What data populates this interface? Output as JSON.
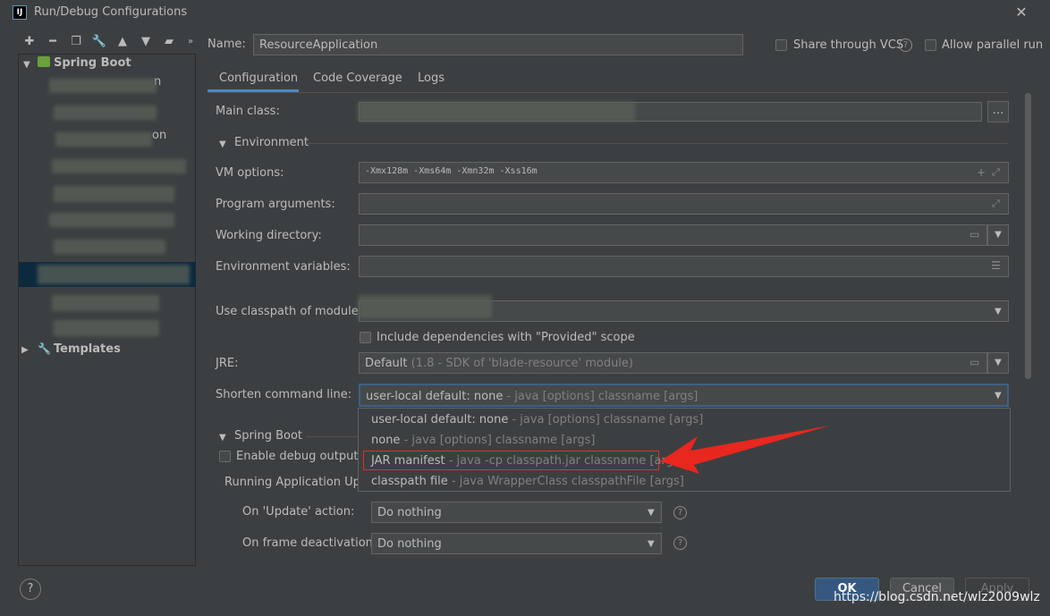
{
  "window": {
    "title": "Run/Debug Configurations",
    "app_icon_text": "IJ"
  },
  "toolbar": {
    "icons": [
      "plus-icon",
      "minus-icon",
      "copy-icon",
      "wrench-icon",
      "arrow-up-icon",
      "arrow-down-icon",
      "folder-icon",
      "chevrons-icon"
    ]
  },
  "sidebar": {
    "spring_boot_label": "Spring Boot",
    "templates_label": "Templates",
    "partial_1": "n",
    "partial_2": "on"
  },
  "header": {
    "name_label": "Name:",
    "name_value": "ResourceApplication",
    "share_vcs_label": "Share through VCS",
    "allow_parallel_label": "Allow parallel run"
  },
  "tabs": [
    {
      "label": "Configuration",
      "active": true
    },
    {
      "label": "Code Coverage",
      "active": false
    },
    {
      "label": "Logs",
      "active": false
    }
  ],
  "form": {
    "main_class_label": "Main class:",
    "environment_label": "Environment",
    "vm_options_label": "VM options:",
    "vm_options_value": "-Xmx128m -Xms64m -Xmn32m -Xss16m",
    "program_args_label": "Program arguments:",
    "working_dir_label": "Working directory:",
    "env_vars_label": "Environment variables:",
    "classpath_label": "Use classpath of module",
    "include_deps_label": "Include dependencies with \"Provided\" scope",
    "jre_label": "JRE:",
    "jre_value": "Default",
    "jre_hint": "(1.8 - SDK of 'blade-resource' module)",
    "shorten_label": "Shorten command line:",
    "shorten_value": "user-local default: none",
    "shorten_hint": " - java [options] classname [args]"
  },
  "dropdown_options": [
    {
      "main": "user-local default: none",
      "hint": " - java [options] classname [args]"
    },
    {
      "main": "none",
      "hint": " - java [options] classname [args]"
    },
    {
      "main": "JAR manifest",
      "hint": " - java -cp classpath.jar classname [args]"
    },
    {
      "main": "classpath file",
      "hint": " - java WrapperClass classpathFile [args]"
    }
  ],
  "spring_boot": {
    "section_label": "Spring Boot",
    "enable_debug_label": "Enable debug output",
    "running_update_label": "Running Application Upda",
    "on_update_label": "On 'Update' action:",
    "on_update_value": "Do nothing",
    "on_frame_label": "On frame deactivation:",
    "on_frame_value": "Do nothing"
  },
  "buttons": {
    "help": "?",
    "ok": "OK",
    "cancel": "Cancel",
    "apply": "Apply"
  },
  "watermark": "https://blog.csdn.net/wlz2009wlz",
  "colors": {
    "accent": "#4a88c7",
    "highlight_box": "#e0302a",
    "arrow": "#e8271f"
  }
}
